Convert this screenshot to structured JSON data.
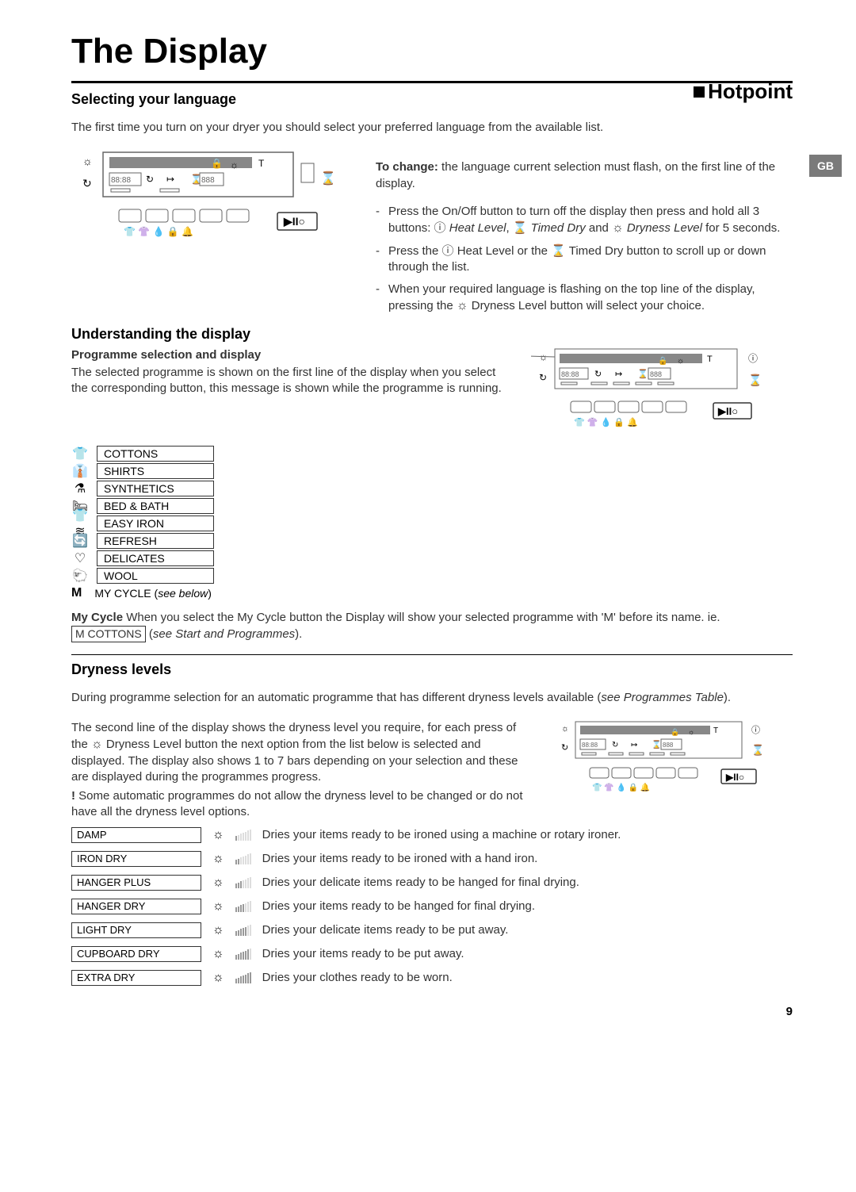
{
  "title": "The Display",
  "brand": "Hotpoint",
  "gb_tab": "GB",
  "selecting": {
    "heading": "Selecting your language",
    "intro": "The first time you turn on your dryer you should select your preferred language from the available list.",
    "to_change_bold": "To change:",
    "to_change_rest": " the language current selection must flash, on the first line of the display.",
    "step1a": "Press the On/Off button to turn off the display then press and hold all 3 buttons: ",
    "step1_heat": "Heat Level",
    "step1_timed": "Timed Dry",
    "step1_and": " and ",
    "step1_dry": "Dryness Level",
    "step1_end": " for 5 seconds.",
    "step2a": "Press the ",
    "step2b": " Heat Level or the ",
    "step2c": " Timed Dry button to scroll up or down through the list.",
    "step3": "When your required language is flashing on the top line of the display, pressing the ",
    "step3b": " Dryness Level button will select your choice."
  },
  "understanding": {
    "heading": "Understanding the display",
    "sub": "Programme selection and display",
    "text": "The selected programme is shown on the first line of the display when you select the corresponding button, this message is shown while the programme is running.",
    "programs": [
      {
        "icon": "tshirt",
        "label": "COTTONS"
      },
      {
        "icon": "shirt",
        "label": "SHIRTS"
      },
      {
        "icon": "flask",
        "label": "SYNTHETICS"
      },
      {
        "icon": "bed",
        "label": "BED & BATH"
      },
      {
        "icon": "iron",
        "label": "EASY IRON"
      },
      {
        "icon": "refresh",
        "label": "REFRESH"
      },
      {
        "icon": "heart",
        "label": "DELICATES"
      },
      {
        "icon": "wool",
        "label": "WOOL"
      }
    ],
    "mycycle_letter": "M",
    "mycycle_label": "MY CYCLE (",
    "mycycle_see": "see below",
    "mycycle_close": ")",
    "mycycle_head": "My Cycle",
    "mycycle_text": " When you select the My Cycle button the Display will show your selected programme with 'M' before its name.  ie. ",
    "mycycle_box": "M  COTTONS",
    "mycycle_paren": " (",
    "mycycle_see2": "see Start and Programmes",
    "mycycle_close2": ")."
  },
  "dryness": {
    "heading": "Dryness levels",
    "p1a": "During programme selection for an automatic programme that has different dryness levels available (",
    "p1_see": "see Programmes Table",
    "p1b": ").",
    "p2": "The second line of the display shows the dryness level you require, for each press of the ",
    "p2b": " Dryness Level button the next option from the list below is selected and displayed. The display also shows 1 to 7 bars depending on your selection and these are displayed during the programmes progress.",
    "note_mark": "!",
    "note": " Some automatic programmes do not allow the dryness level to be changed or do not have all the dryness level options.",
    "levels": [
      {
        "label": "DAMP",
        "bars": 1,
        "desc": "Dries your items ready to be ironed using a machine or rotary ironer."
      },
      {
        "label": "IRON DRY",
        "bars": 2,
        "desc": "Dries your items ready to be ironed with a hand iron."
      },
      {
        "label": "HANGER PLUS",
        "bars": 3,
        "desc": "Dries your delicate items ready to be hanged for final drying."
      },
      {
        "label": "HANGER DRY",
        "bars": 4,
        "desc": "Dries your items ready to be hanged for final drying."
      },
      {
        "label": "LIGHT DRY",
        "bars": 5,
        "desc": "Dries your delicate items ready to be put away."
      },
      {
        "label": "CUPBOARD DRY",
        "bars": 6,
        "desc": "Dries your items ready to be put away."
      },
      {
        "label": "EXTRA DRY",
        "bars": 7,
        "desc": "Dries your clothes ready to be worn."
      }
    ]
  },
  "page_num": "9"
}
